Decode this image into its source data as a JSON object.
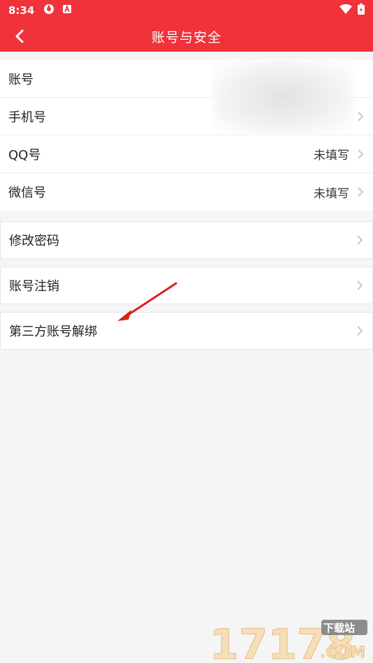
{
  "status_bar": {
    "time": "8:34"
  },
  "app_bar": {
    "title": "账号与安全"
  },
  "account_group": [
    {
      "label": "账号",
      "value": ""
    },
    {
      "label": "手机号",
      "value": ""
    },
    {
      "label": "QQ号",
      "value": "未填写"
    },
    {
      "label": "微信号",
      "value": "未填写"
    }
  ],
  "cards": [
    {
      "label": "修改密码"
    },
    {
      "label": "账号注销"
    },
    {
      "label": "第三方账号解绑"
    }
  ],
  "watermark": {
    "number": "17178",
    "tag": "下载站",
    "domain": ".COM"
  },
  "colors": {
    "accent": "#f0323a",
    "arrow": "#d9201c"
  }
}
